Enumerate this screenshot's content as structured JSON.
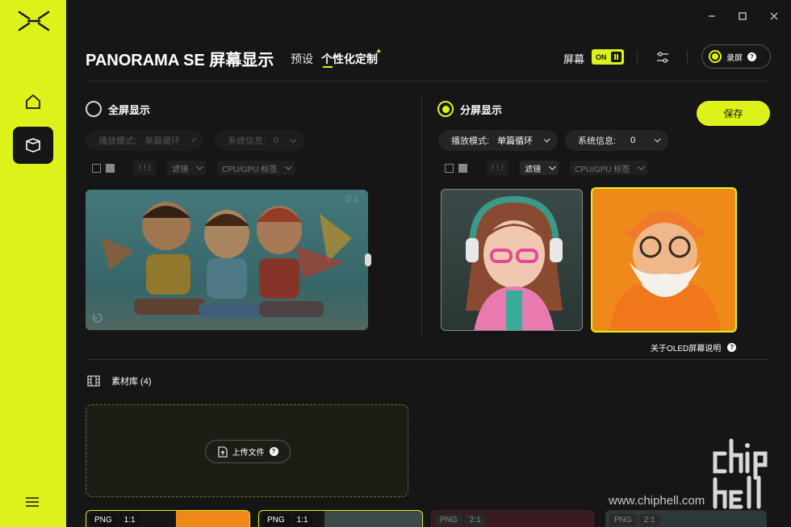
{
  "sidebar": {
    "items": [
      {
        "name": "home-icon"
      },
      {
        "name": "device-icon"
      }
    ]
  },
  "header": {
    "title": "PANORAMA SE 屏幕显示",
    "tabs": [
      {
        "label": "预设"
      },
      {
        "label": "个性化定制",
        "active": true
      }
    ],
    "screen_label": "屏幕",
    "screen_toggle": "ON",
    "record_label": "录屏"
  },
  "full_screen": {
    "label": "全屏显示",
    "play_mode_label": "播放模式:",
    "play_mode_value": "单篇循环",
    "sysinfo_label": "系统信息:",
    "sysinfo_value": "0",
    "filter_label": "滤镜",
    "cpu_label": "CPU/GPU 标签",
    "align_glyphs": "⁝  ⁝  ⁝",
    "ratio": "2:1"
  },
  "split_screen": {
    "label": "分屏显示",
    "play_mode_label": "播放模式:",
    "play_mode_value": "单篇循环",
    "sysinfo_label": "系统信息:",
    "sysinfo_value": "0",
    "filter_label": "滤镜",
    "cpu_label": "CPU/GPU 标签",
    "align_glyphs": "⁝  ⁝  ⁝"
  },
  "save_label": "保存",
  "oled_link": "关于OLED屏幕说明",
  "library": {
    "title": "素材库 (4)",
    "upload_label": "上传文件",
    "thumbs": [
      {
        "format": "PNG",
        "ratio": "1:1"
      },
      {
        "format": "PNG",
        "ratio": "1:1"
      },
      {
        "format": "PNG",
        "ratio": "2:1"
      },
      {
        "format": "PNG",
        "ratio": "2:1"
      }
    ]
  },
  "watermark": "www.chiphell.com",
  "colors": {
    "accent": "#dcf21a",
    "background": "#161616"
  }
}
